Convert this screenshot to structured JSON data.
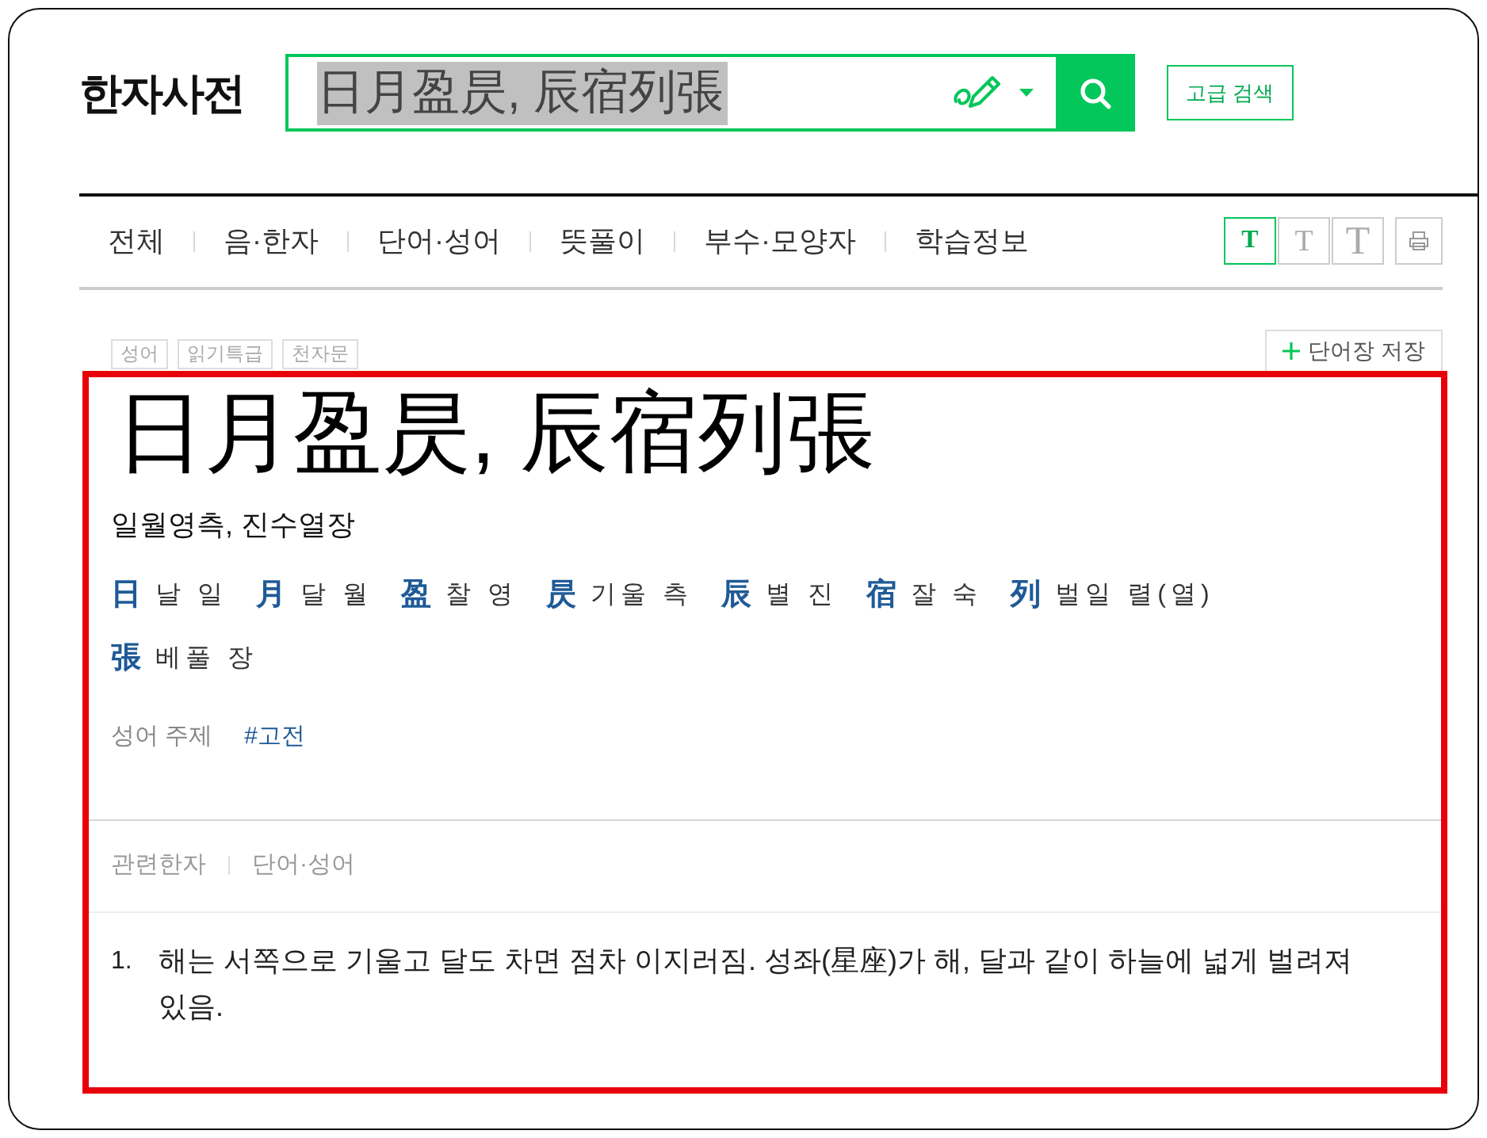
{
  "header": {
    "logo": "한자사전",
    "search": {
      "query": "日月盈昃, 辰宿列張",
      "query_selected": true
    },
    "advanced_search": "고급 검색"
  },
  "nav": {
    "tabs": [
      {
        "label": "전체",
        "selected": false
      },
      {
        "label": "음·한자",
        "selected": false
      },
      {
        "label": "단어·성어",
        "selected": false
      },
      {
        "label": "뜻풀이",
        "selected": false
      },
      {
        "label": "부수·모양자",
        "selected": false
      },
      {
        "label": "학습정보",
        "selected": false
      }
    ],
    "font_sizes": [
      {
        "label": "T",
        "kind": "small",
        "selected": true
      },
      {
        "label": "T",
        "kind": "medium",
        "selected": false
      },
      {
        "label": "T",
        "kind": "large",
        "selected": false
      }
    ]
  },
  "entry": {
    "tags": [
      "성어",
      "읽기특급",
      "천자문"
    ],
    "save_button": "단어장 저장",
    "title": "日月盈昃, 辰宿列張",
    "reading": "일월영측, 진수열장",
    "characters": [
      {
        "hanja": "日",
        "meaning": "날 일"
      },
      {
        "hanja": "月",
        "meaning": "달 월"
      },
      {
        "hanja": "盈",
        "meaning": "찰 영"
      },
      {
        "hanja": "昃",
        "meaning": "기울 측"
      },
      {
        "hanja": "辰",
        "meaning": "별 진"
      },
      {
        "hanja": "宿",
        "meaning": "잘 숙"
      },
      {
        "hanja": "列",
        "meaning": "벌일 렬(열)"
      },
      {
        "hanja": "張",
        "meaning": "베풀 장"
      }
    ],
    "topic": {
      "label": "성어 주제",
      "tag": "#고전"
    },
    "related_tabs": [
      "관련한자",
      "단어·성어"
    ],
    "definitions": [
      {
        "number": "1.",
        "text": "해는 서쪽으로 기울고 달도 차면 점차 이지러짐. 성좌(星座)가 해, 달과 같이 하늘에 넓게 벌려져 있음."
      }
    ]
  },
  "annotation_box": true
}
